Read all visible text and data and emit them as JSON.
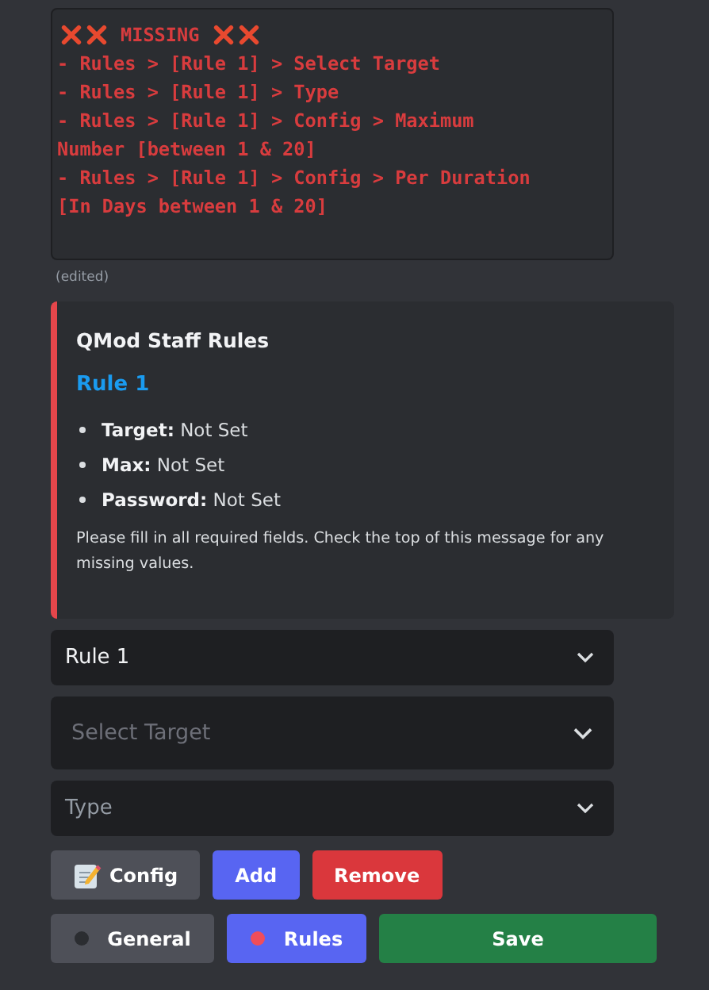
{
  "code_block": {
    "title": "MISSING",
    "lines": [
      "- Rules > [Rule 1] > Select Target",
      "- Rules > [Rule 1] > Type",
      "- Rules > [Rule 1] > Config > Maximum",
      "Number [between 1 & 20]",
      "- Rules > [Rule 1] > Config > Per Duration",
      "[In Days between 1 & 20]"
    ]
  },
  "edited_label": "(edited)",
  "embed": {
    "color": "#e5464b",
    "title": "QMod Staff Rules",
    "subtitle": "Rule 1",
    "fields": [
      {
        "label": "Target:",
        "value": "Not Set"
      },
      {
        "label": "Max:",
        "value": "Not Set"
      },
      {
        "label": "Password:",
        "value": "Not Set"
      }
    ],
    "footer": "Please fill in all required fields. Check the top of this message for any missing values."
  },
  "selects": [
    {
      "kind": "value",
      "text": "Rule 1"
    },
    {
      "kind": "large",
      "text": "Select Target"
    },
    {
      "kind": "placeholder",
      "text": "Type"
    }
  ],
  "action_buttons": [
    {
      "kind": "config",
      "label": "Config"
    },
    {
      "kind": "add",
      "label": "Add"
    },
    {
      "kind": "remove",
      "label": "Remove"
    }
  ],
  "nav_buttons": [
    {
      "label": "General",
      "selected": false,
      "color": "#2b2d31"
    },
    {
      "label": "Rules",
      "selected": true,
      "color": "#f04d5b"
    }
  ],
  "save_button": {
    "label": "Save"
  }
}
